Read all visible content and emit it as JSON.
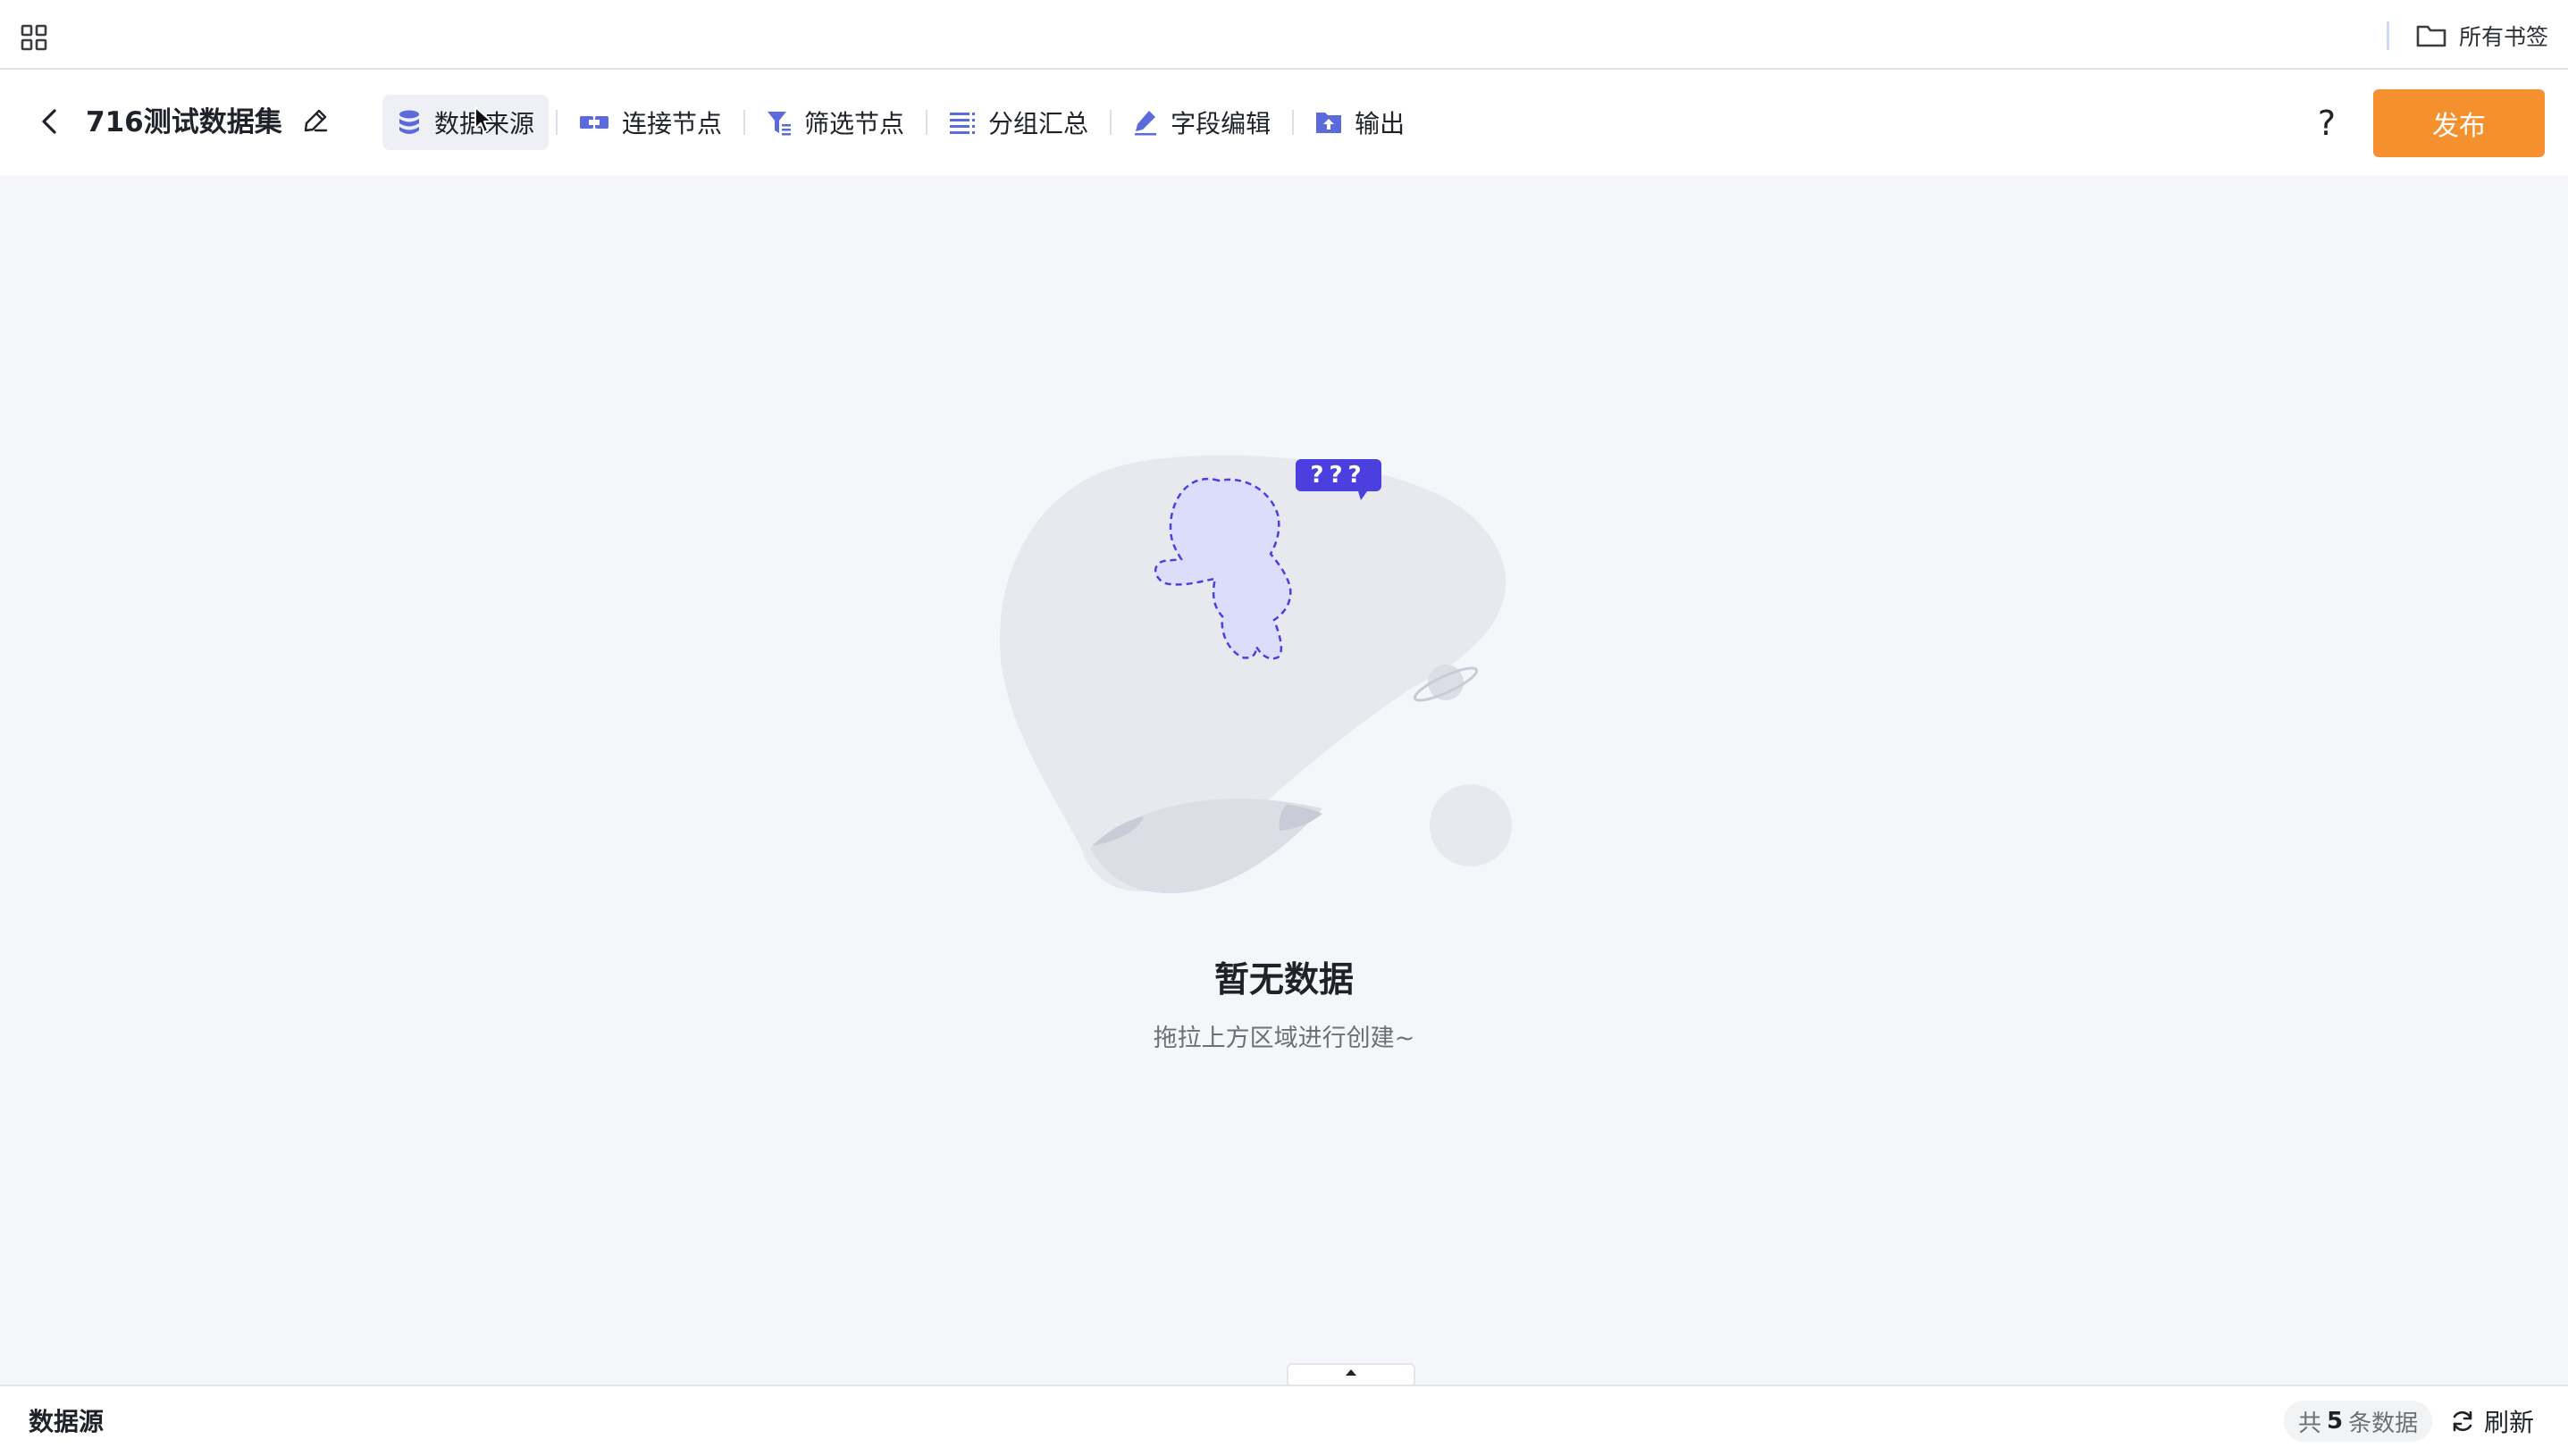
{
  "bookmark_bar": {
    "apps_icon": "grid-icon",
    "all_bookmarks_label": "所有书签"
  },
  "toolbar": {
    "title": "716测试数据集",
    "nodes": [
      {
        "label": "数据来源",
        "icon": "database-icon",
        "active": true
      },
      {
        "label": "连接节点",
        "icon": "join-icon",
        "active": false
      },
      {
        "label": "筛选节点",
        "icon": "filter-icon",
        "active": false
      },
      {
        "label": "分组汇总",
        "icon": "group-list-icon",
        "active": false
      },
      {
        "label": "字段编辑",
        "icon": "pen-icon",
        "active": false
      },
      {
        "label": "输出",
        "icon": "folder-upload-icon",
        "active": false
      }
    ],
    "help_label": "?",
    "publish_label": "发布"
  },
  "canvas": {
    "empty_illustration_bubble": "???",
    "empty_title": "暂无数据",
    "empty_subtitle": "拖拉上方区域进行创建~"
  },
  "bottom_panel": {
    "title": "数据源",
    "count_prefix": "共",
    "count_value": "5",
    "count_suffix": "条数据",
    "refresh_label": "刷新"
  },
  "colors": {
    "accent_orange": "#f5902e",
    "node_icon_blue": "#5b6bdc",
    "illustration_purple": "#4b3fe0"
  }
}
